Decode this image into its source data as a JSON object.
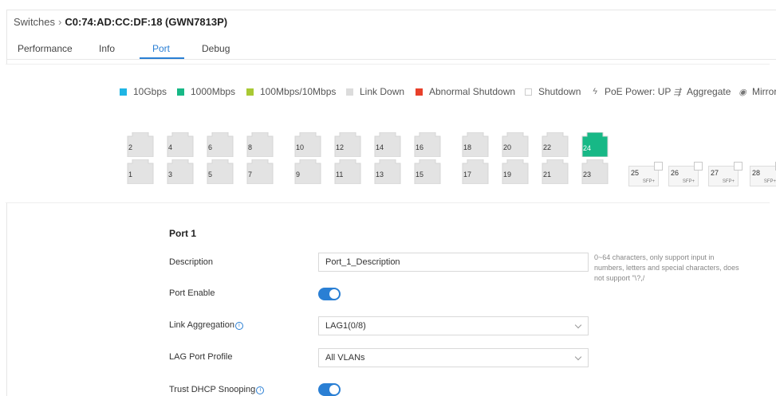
{
  "breadcrumb": {
    "parent": "Switches",
    "separator": "›",
    "device": "C0:74:AD:CC:DF:18 (GWN7813P)"
  },
  "tabs": [
    {
      "label": "Performance",
      "active": false
    },
    {
      "label": "Info",
      "active": false
    },
    {
      "label": "Port",
      "active": true
    },
    {
      "label": "Debug",
      "active": false
    }
  ],
  "legend": [
    {
      "label": "10Gbps",
      "color": "#1fb5e4",
      "icon": "square"
    },
    {
      "label": "1000Mbps",
      "color": "#17b886",
      "icon": "square"
    },
    {
      "label": "100Mbps/10Mbps",
      "color": "#a9c934",
      "icon": "square"
    },
    {
      "label": "Link Down",
      "color": "#dcdcdc",
      "icon": "square"
    },
    {
      "label": "Abnormal Shutdown",
      "color": "#e8402a",
      "icon": "square"
    },
    {
      "label": "Shutdown",
      "color": "#ffffff",
      "icon": "square-outline"
    },
    {
      "label": "PoE Power: UP",
      "icon": "bolt-icon"
    },
    {
      "label": "Aggregate",
      "icon": "aggregate-icon"
    },
    {
      "label": "Mirror",
      "icon": "mirror-icon"
    }
  ],
  "ports": {
    "top": [
      "2",
      "4",
      "6",
      "8",
      "10",
      "12",
      "14",
      "16",
      "18",
      "20",
      "22",
      "24"
    ],
    "bottom": [
      "1",
      "3",
      "5",
      "7",
      "9",
      "11",
      "13",
      "15",
      "17",
      "19",
      "21",
      "23"
    ],
    "active_port": "24",
    "checked_port": "1",
    "sfp": [
      {
        "num": "25",
        "label": "SFP+"
      },
      {
        "num": "26",
        "label": "SFP+"
      },
      {
        "num": "27",
        "label": "SFP+"
      },
      {
        "num": "28",
        "label": "SFP+"
      }
    ],
    "colors": {
      "link_down": "#e3e3e3",
      "active": "#17b886"
    }
  },
  "form": {
    "title": "Port 1",
    "description": {
      "label": "Description",
      "value": "Port_1_Description",
      "hint": "0~64 characters, only support input in numbers, letters and special characters, does not support \"\\?,/"
    },
    "port_enable": {
      "label": "Port Enable",
      "on": true
    },
    "link_aggregation": {
      "label": "Link Aggregation",
      "value": "LAG1(0/8)"
    },
    "lag_port_profile": {
      "label": "LAG Port Profile",
      "value": "All VLANs"
    },
    "trust_dhcp": {
      "label": "Trust DHCP Snooping",
      "on": true
    }
  },
  "accent_color": "#2a7fd4"
}
